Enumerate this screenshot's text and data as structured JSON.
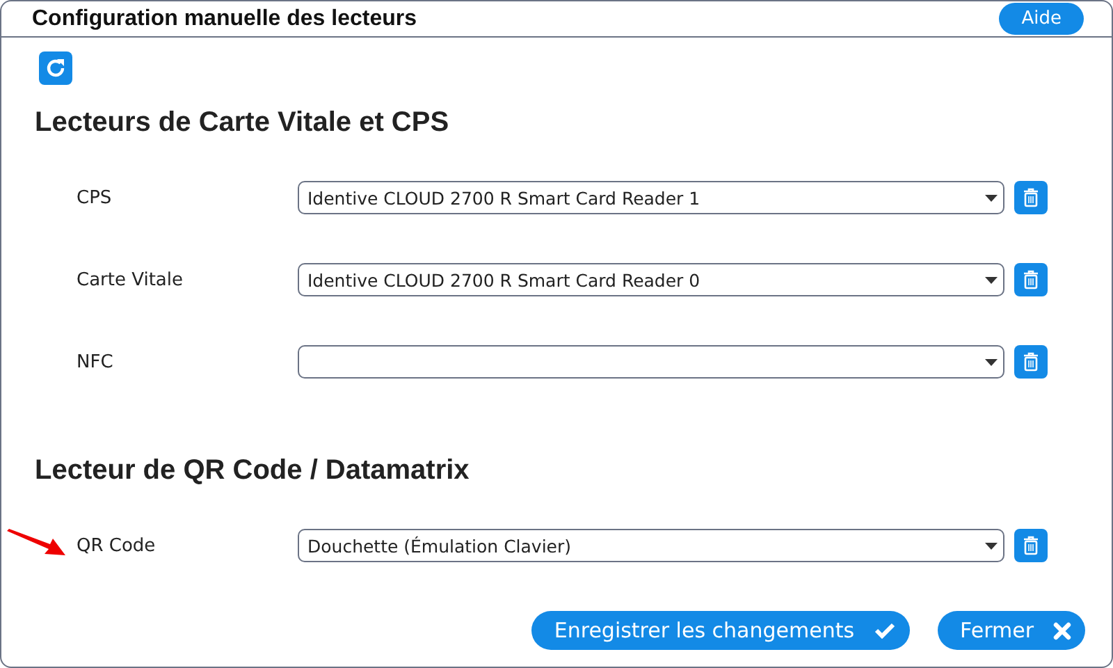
{
  "window": {
    "title": "Configuration manuelle des lecteurs",
    "help_button": "Aide"
  },
  "sections": [
    {
      "heading": "Lecteurs de Carte Vitale et CPS",
      "rows": [
        {
          "label": "CPS",
          "value": "Identive CLOUD 2700 R Smart Card Reader 1",
          "highlighted": false
        },
        {
          "label": "Carte Vitale",
          "value": "Identive CLOUD 2700 R Smart Card Reader 0",
          "highlighted": false
        },
        {
          "label": "NFC",
          "highlighted": false
        }
      ]
    },
    {
      "heading": "Lecteur de QR Code / Datamatrix",
      "rows": [
        {
          "label": "QR Code",
          "value": "Douchette (Émulation Clavier)",
          "highlighted": true
        }
      ]
    }
  ],
  "buttons": [
    {
      "label": "Enregistrer les changements",
      "kind": "save"
    },
    {
      "label": "Fermer",
      "kind": "close"
    }
  ]
}
